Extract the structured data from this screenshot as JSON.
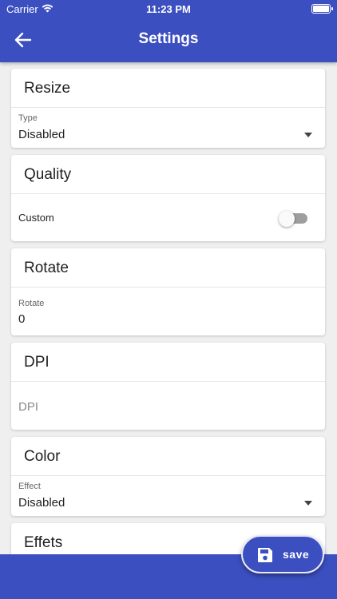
{
  "status_bar": {
    "carrier": "Carrier",
    "time": "11:23 PM"
  },
  "header": {
    "title": "Settings",
    "back_icon": "arrow-back-icon"
  },
  "sections": {
    "resize": {
      "title": "Resize",
      "type_label": "Type",
      "type_value": "Disabled"
    },
    "quality": {
      "title": "Quality",
      "custom_label": "Custom",
      "custom_enabled": false
    },
    "rotate": {
      "title": "Rotate",
      "rotate_label": "Rotate",
      "rotate_value": "0"
    },
    "dpi": {
      "title": "DPI",
      "dpi_placeholder": "DPI"
    },
    "color": {
      "title": "Color",
      "effect_label": "Effect",
      "effect_value": "Disabled"
    },
    "effects": {
      "title": "Effets"
    }
  },
  "fab": {
    "label": "save",
    "icon": "save-icon"
  },
  "colors": {
    "primary": "#3c4fc1",
    "background": "#efefef",
    "card": "#ffffff"
  }
}
